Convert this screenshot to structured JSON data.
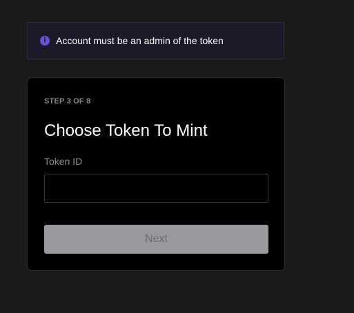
{
  "notice": {
    "icon": "info-icon",
    "icon_glyph": "i",
    "text": "Account must be an admin of the token",
    "accent_color": "#6c4fd9"
  },
  "form": {
    "step": "STEP 3 OF 8",
    "title": "Choose Token To Mint",
    "token_id_label": "Token ID",
    "token_id_value": "",
    "token_id_placeholder": "",
    "next_label": "Next",
    "next_enabled": false
  }
}
